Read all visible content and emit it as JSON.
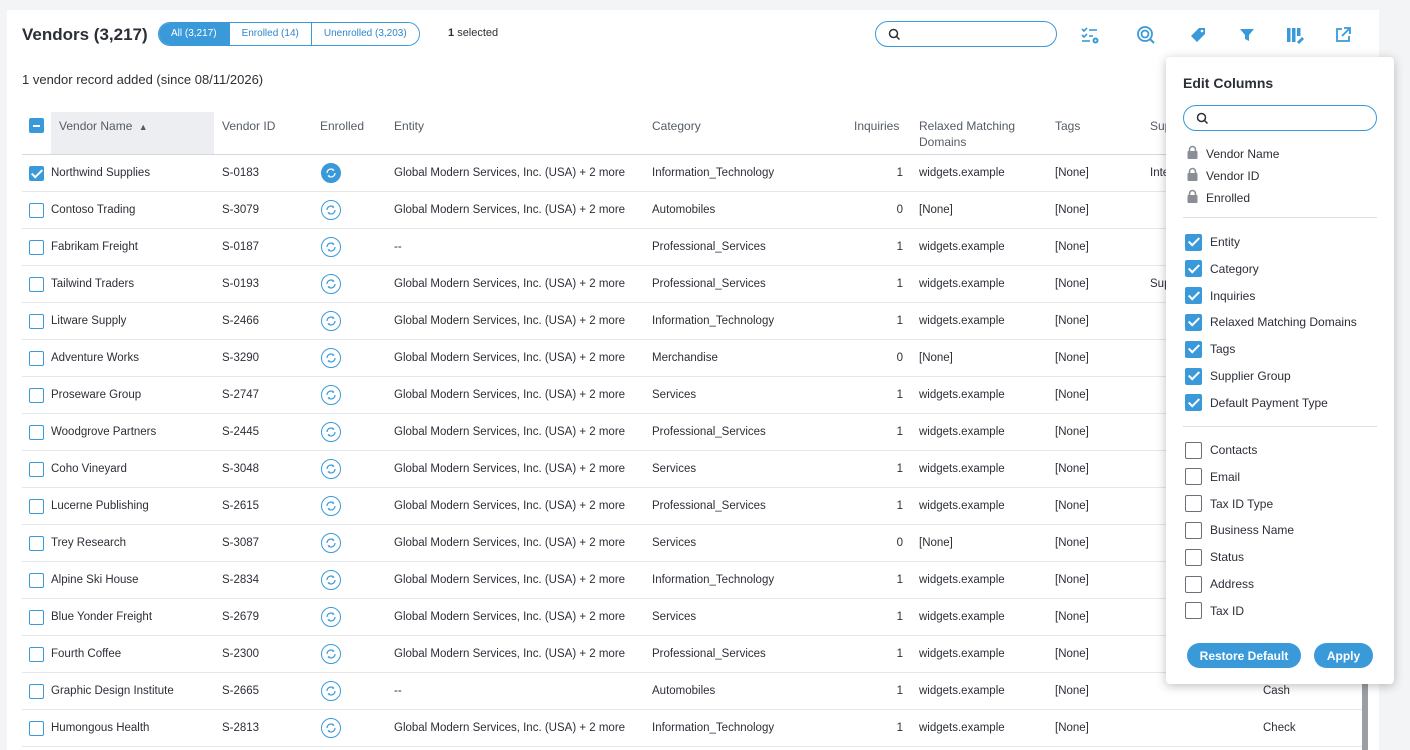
{
  "header": {
    "title": "Vendors (3,217)",
    "filters": [
      {
        "label": "All (3,217)",
        "active": true
      },
      {
        "label": "Enrolled (14)",
        "active": false
      },
      {
        "label": "Unenrolled (3,203)",
        "active": false
      }
    ],
    "selected_count": "1",
    "selected_text": "selected",
    "search_value": "",
    "toolbar_icons": [
      "checklist-settings-icon",
      "target-search-icon",
      "tag-icon",
      "filter-icon",
      "edit-columns-icon",
      "export-icon"
    ]
  },
  "notice": "1 vendor record added (since 08/11/2026)",
  "columns": [
    "Vendor Name",
    "Vendor ID",
    "Enrolled",
    "Entity",
    "Category",
    "Inquiries",
    "Relaxed Matching Domains",
    "Tags",
    "Sup"
  ],
  "rows": [
    {
      "name": "Northwind Supplies",
      "id": "S-0183",
      "enrolled": true,
      "entity": "Global Modern Services, Inc. (USA) + 2 more",
      "category": "Information_Technology",
      "inquiries": "1",
      "domains": "widgets.example",
      "tags": "[None]",
      "extra": "Inte",
      "checked": true
    },
    {
      "name": "Contoso Trading",
      "id": "S-3079",
      "enrolled": false,
      "entity": "Global Modern Services, Inc. (USA) + 2 more",
      "category": "Automobiles",
      "inquiries": "0",
      "domains": "[None]",
      "tags": "[None]",
      "extra": "",
      "checked": false
    },
    {
      "name": "Fabrikam Freight",
      "id": "S-0187",
      "enrolled": false,
      "entity": "--",
      "category": "Professional_Services",
      "inquiries": "1",
      "domains": "widgets.example",
      "tags": "[None]",
      "extra": "",
      "checked": false
    },
    {
      "name": "Tailwind Traders",
      "id": "S-0193",
      "enrolled": false,
      "entity": "Global Modern Services, Inc. (USA) + 2 more",
      "category": "Professional_Services",
      "inquiries": "1",
      "domains": "widgets.example",
      "tags": "[None]",
      "extra": "Sup",
      "checked": false
    },
    {
      "name": "Litware Supply",
      "id": "S-2466",
      "enrolled": false,
      "entity": "Global Modern Services, Inc. (USA) + 2 more",
      "category": "Information_Technology",
      "inquiries": "1",
      "domains": "widgets.example",
      "tags": "[None]",
      "extra": "",
      "checked": false
    },
    {
      "name": "Adventure Works",
      "id": "S-3290",
      "enrolled": false,
      "entity": "Global Modern Services, Inc. (USA) + 2 more",
      "category": "Merchandise",
      "inquiries": "0",
      "domains": "[None]",
      "tags": "[None]",
      "extra": "",
      "checked": false
    },
    {
      "name": "Proseware Group",
      "id": "S-2747",
      "enrolled": false,
      "entity": "Global Modern Services, Inc. (USA) + 2 more",
      "category": "Services",
      "inquiries": "1",
      "domains": "widgets.example",
      "tags": "[None]",
      "extra": "",
      "checked": false
    },
    {
      "name": "Woodgrove Partners",
      "id": "S-2445",
      "enrolled": false,
      "entity": "Global Modern Services, Inc. (USA) + 2 more",
      "category": "Professional_Services",
      "inquiries": "1",
      "domains": "widgets.example",
      "tags": "[None]",
      "extra": "",
      "checked": false
    },
    {
      "name": "Coho Vineyard",
      "id": "S-3048",
      "enrolled": false,
      "entity": "Global Modern Services, Inc. (USA) + 2 more",
      "category": "Services",
      "inquiries": "1",
      "domains": "widgets.example",
      "tags": "[None]",
      "extra": "",
      "checked": false
    },
    {
      "name": "Lucerne Publishing",
      "id": "S-2615",
      "enrolled": false,
      "entity": "Global Modern Services, Inc. (USA) + 2 more",
      "category": "Professional_Services",
      "inquiries": "1",
      "domains": "widgets.example",
      "tags": "[None]",
      "extra": "",
      "checked": false
    },
    {
      "name": "Trey Research",
      "id": "S-3087",
      "enrolled": false,
      "entity": "Global Modern Services, Inc. (USA) + 2 more",
      "category": "Services",
      "inquiries": "0",
      "domains": "[None]",
      "tags": "[None]",
      "extra": "",
      "checked": false
    },
    {
      "name": "Alpine Ski House",
      "id": "S-2834",
      "enrolled": false,
      "entity": "Global Modern Services, Inc. (USA) + 2 more",
      "category": "Information_Technology",
      "inquiries": "1",
      "domains": "widgets.example",
      "tags": "[None]",
      "extra": "",
      "checked": false
    },
    {
      "name": "Blue Yonder Freight",
      "id": "S-2679",
      "enrolled": false,
      "entity": "Global Modern Services, Inc. (USA) + 2 more",
      "category": "Services",
      "inquiries": "1",
      "domains": "widgets.example",
      "tags": "[None]",
      "extra": "",
      "checked": false
    },
    {
      "name": "Fourth Coffee",
      "id": "S-2300",
      "enrolled": false,
      "entity": "Global Modern Services, Inc. (USA) + 2 more",
      "category": "Professional_Services",
      "inquiries": "1",
      "domains": "widgets.example",
      "tags": "[None]",
      "extra": "",
      "checked": false
    },
    {
      "name": "Graphic Design Institute",
      "id": "S-2665",
      "enrolled": false,
      "entity": "--",
      "category": "Automobiles",
      "inquiries": "1",
      "domains": "widgets.example",
      "tags": "[None]",
      "extra": "Cash",
      "checked": false
    },
    {
      "name": "Humongous Health",
      "id": "S-2813",
      "enrolled": false,
      "entity": "Global Modern Services, Inc. (USA) + 2 more",
      "category": "Information_Technology",
      "inquiries": "1",
      "domains": "widgets.example",
      "tags": "[None]",
      "extra": "Check",
      "checked": false
    }
  ],
  "edit_columns": {
    "title": "Edit Columns",
    "search_value": "",
    "locked": [
      "Vendor Name",
      "Vendor ID",
      "Enrolled"
    ],
    "checked": [
      "Entity",
      "Category",
      "Inquiries",
      "Relaxed Matching Domains",
      "Tags",
      "Supplier Group",
      "Default Payment Type"
    ],
    "unchecked": [
      "Contacts",
      "Email",
      "Tax ID Type",
      "Business Name",
      "Status",
      "Address",
      "Tax ID"
    ],
    "restore_label": "Restore Default",
    "apply_label": "Apply"
  },
  "colors": {
    "accent": "#3a9ad9",
    "text": "#2b2f36",
    "muted": "#555c66"
  }
}
